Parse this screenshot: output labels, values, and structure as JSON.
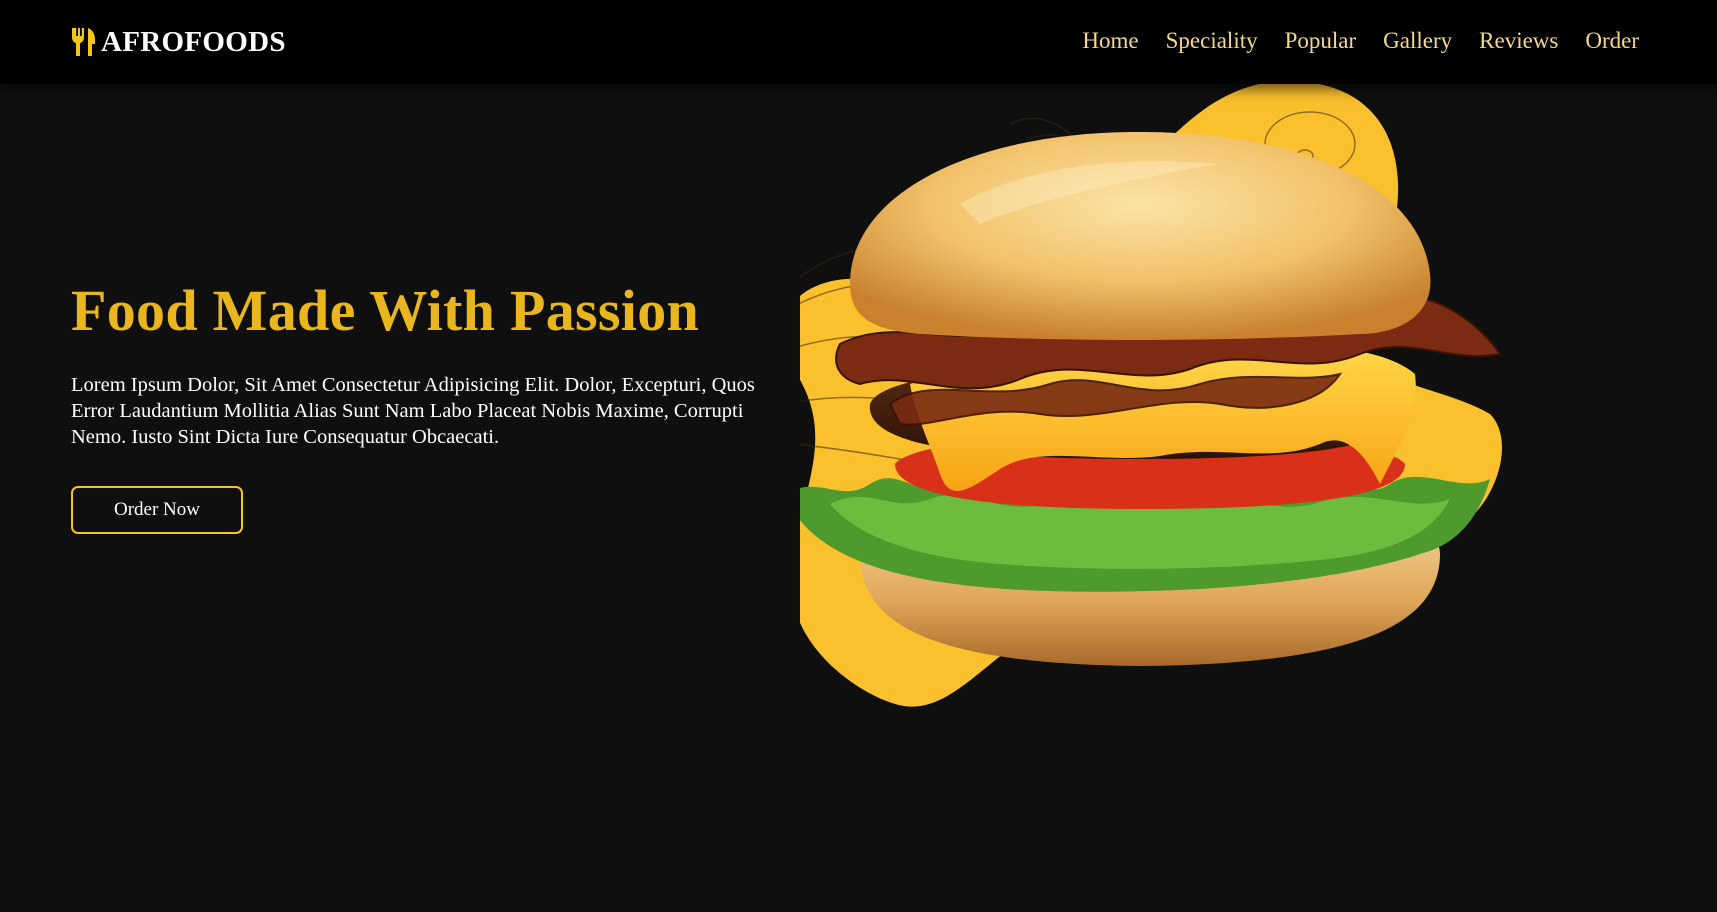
{
  "header": {
    "brand": {
      "name": "AFROFOODS",
      "icon": "fork-knife-icon"
    },
    "nav": [
      {
        "label": "Home"
      },
      {
        "label": "Speciality"
      },
      {
        "label": "Popular"
      },
      {
        "label": "Gallery"
      },
      {
        "label": "Reviews"
      },
      {
        "label": "Order"
      }
    ]
  },
  "hero": {
    "title": "Food Made With Passion",
    "description": "Lorem Ipsum Dolor, Sit Amet Consectetur Adipisicing Elit. Dolor, Excepturi, Quos Error Laudantium Mollitia Alias Sunt Nam Labo Placeat Nobis Maxime, Corrupti Nemo. Iusto Sint Dicta Iure Consequatur Obcaecati.",
    "cta_label": "Order Now",
    "image": "burger-image"
  },
  "colors": {
    "background": "#0f0f10",
    "header_bg": "#000000",
    "accent": "#e9b71d",
    "nav_text": "#f7d98a",
    "blob": "#fbc02d",
    "body_text": "#ffffff"
  }
}
